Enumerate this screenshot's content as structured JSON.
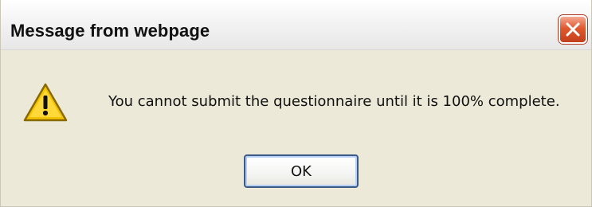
{
  "window": {
    "title": "Message from webpage",
    "close_icon": "close-icon"
  },
  "dialog": {
    "icon": "warning-icon",
    "message": "You cannot submit the questionnaire until it is 100% complete.",
    "ok_label": "OK"
  },
  "colors": {
    "dialog_background": "#ece9d8",
    "titlebar_top": "#ffffff",
    "close_button_red": "#e05a2f",
    "warning_yellow": "#f4c400",
    "button_border": "#3c5a88"
  }
}
